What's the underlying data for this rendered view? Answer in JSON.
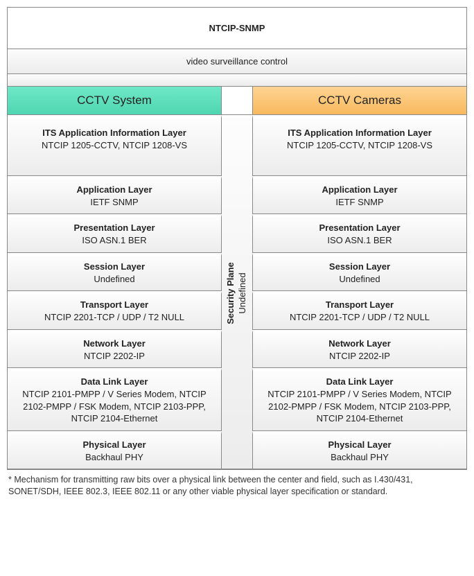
{
  "title": "NTCIP-SNMP",
  "subtitle": "video surveillance control",
  "columns": {
    "left": "CCTV System",
    "right": "CCTV Cameras"
  },
  "security_plane": {
    "title": "Security Plane",
    "body": "Undefined"
  },
  "layers": [
    {
      "title": "ITS Application Information Layer",
      "body": "NTCIP 1205-CCTV, NTCIP 1208-VS",
      "tall": true
    },
    {
      "title": "Application Layer",
      "body": "IETF SNMP"
    },
    {
      "title": "Presentation Layer",
      "body": "ISO ASN.1 BER"
    },
    {
      "title": "Session Layer",
      "body": "Undefined"
    },
    {
      "title": "Transport Layer",
      "body": "NTCIP 2201-TCP / UDP / T2 NULL"
    },
    {
      "title": "Network Layer",
      "body": "NTCIP 2202-IP"
    },
    {
      "title": "Data Link Layer",
      "body": "NTCIP 2101-PMPP / V Series Modem, NTCIP 2102-PMPP / FSK Modem, NTCIP 2103-PPP, NTCIP 2104-Ethernet"
    },
    {
      "title": "Physical Layer",
      "body": "Backhaul PHY"
    }
  ],
  "footnote": "* Mechanism for transmitting raw bits over a physical link between the center and field, such as I.430/431, SONET/SDH, IEEE 802.3, IEEE 802.11 or any other viable physical layer specification or standard."
}
